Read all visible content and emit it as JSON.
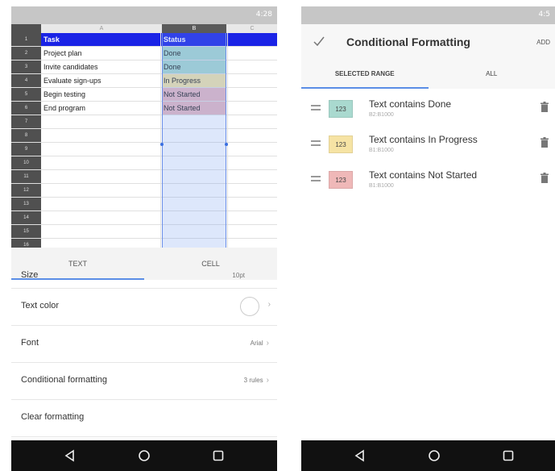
{
  "left": {
    "status_bar": "4:28",
    "sheet": {
      "columns": [
        "A",
        "B",
        "C"
      ],
      "row_numbers": [
        "1",
        "2",
        "3",
        "4",
        "5",
        "6",
        "7",
        "8",
        "9",
        "10",
        "11",
        "12",
        "13",
        "14",
        "15",
        "16"
      ],
      "rows": [
        {
          "a": "Task",
          "b": "Status"
        },
        {
          "a": "Project plan",
          "b": "Done"
        },
        {
          "a": "Invite candidates",
          "b": "Done"
        },
        {
          "a": "Evaluate sign-ups",
          "b": "In Progress"
        },
        {
          "a": "Begin testing",
          "b": "Not Started"
        },
        {
          "a": "End program",
          "b": "Not Started"
        }
      ],
      "colors": {
        "header": "#1a23e6",
        "done": "#a9d9cf",
        "in_progress": "#f3e4a8",
        "not_started": "#e7b9c1"
      }
    },
    "tabs": {
      "text": "TEXT",
      "cell": "CELL"
    },
    "list": {
      "size_label": "Size",
      "size_value": "10pt",
      "text_color_label": "Text color",
      "font_label": "Font",
      "font_value": "Arial",
      "conditional_label": "Conditional formatting",
      "conditional_value": "3 rules",
      "clear_label": "Clear formatting"
    }
  },
  "right": {
    "status_bar": "4:5",
    "title": "Conditional Formatting",
    "add_label": "ADD",
    "tabs": {
      "selected": "SELECTED RANGE",
      "all": "ALL"
    },
    "rules": [
      {
        "swatch": "123",
        "color": "#a9d9cf",
        "title": "Text contains Done",
        "range": "B2:B1000"
      },
      {
        "swatch": "123",
        "color": "#f6e3a4",
        "title": "Text contains In Progress",
        "range": "B1:B1000"
      },
      {
        "swatch": "123",
        "color": "#efb8b8",
        "title": "Text contains Not Started",
        "range": "B1:B1000"
      }
    ]
  }
}
